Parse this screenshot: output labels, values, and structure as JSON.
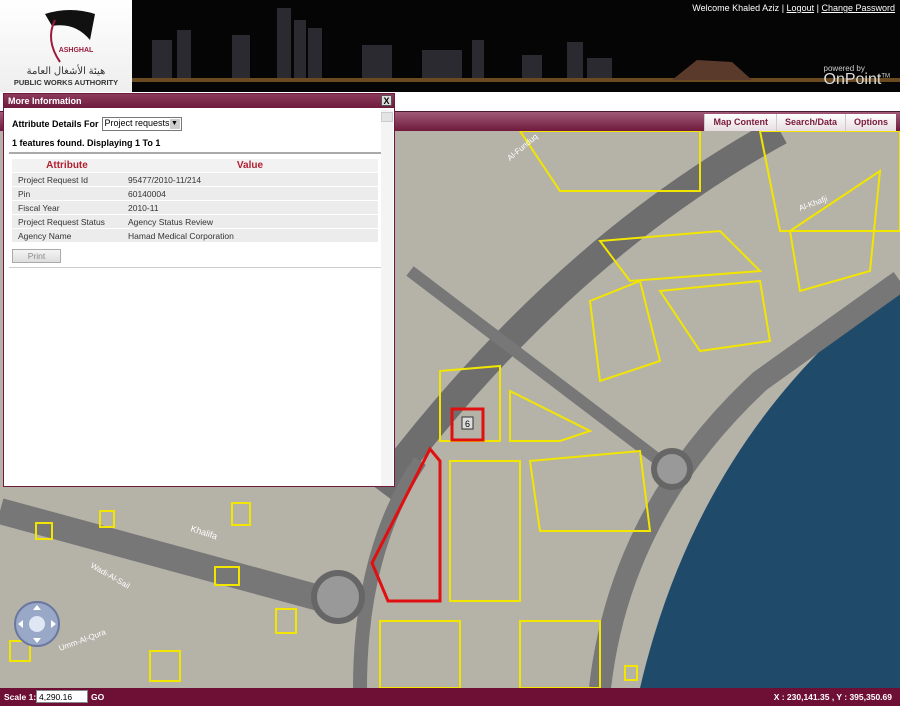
{
  "header": {
    "logo_ar": "هيئة الأشغال العامة",
    "logo_en": "PUBLIC WORKS AUTHORITY",
    "logo_brand": "ASHGHAL",
    "welcome": "Welcome Khaled Aziz",
    "sep": "|",
    "logout": "Logout",
    "change_password": "Change Password",
    "powered_by": "powered by",
    "onpoint": "OnPoint",
    "tm": "TM"
  },
  "toolbar": {
    "tabs": [
      "Map Content",
      "Search/Data",
      "Options"
    ]
  },
  "popup": {
    "title": "More Information",
    "close": "X",
    "attr_label": "Attribute Details For",
    "select_value": "Project requests",
    "found": "1 features found. Displaying 1 To 1",
    "columns": [
      "Attribute",
      "Value"
    ],
    "rows": [
      [
        "Project Request Id",
        "95477/2010-11/214"
      ],
      [
        "Pin",
        "60140004"
      ],
      [
        "Fiscal Year",
        "2010-11"
      ],
      [
        "Project Request Status",
        "Agency Status Review"
      ],
      [
        "Agency Name",
        "Hamad Medical Corporation"
      ]
    ],
    "print": "Print"
  },
  "map": {
    "parcel_label": "6",
    "streets": [
      "Khalifa",
      "Al-Funduq",
      "Wadi-Al-Sail",
      "Umm-Al-Qura",
      "Al-Khafji"
    ],
    "parcel_color": "#f2e600",
    "highlight_color": "#e01010"
  },
  "footer": {
    "scale_label": "Scale 1:",
    "scale_value": "4,290.16",
    "go": "GO",
    "coords": "X : 230,141.35 , Y : 395,350.69"
  }
}
